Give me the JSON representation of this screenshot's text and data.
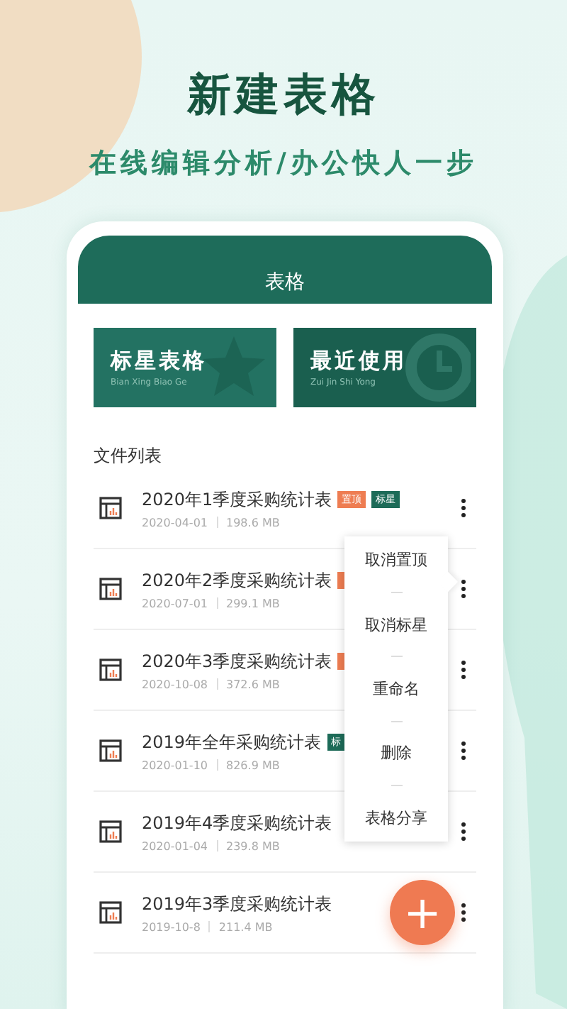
{
  "headline": "新建表格",
  "tagline": "在线编辑分析/办公快人一步",
  "app": {
    "title": "表格",
    "cards": [
      {
        "kind": "star",
        "title": "标星表格",
        "subtitle": "Bian Xing Biao Ge"
      },
      {
        "kind": "clock",
        "title": "最近使用",
        "subtitle": "Zui Jin Shi Yong"
      }
    ],
    "section_title": "文件列表",
    "files": [
      {
        "name": "2020年1季度采购统计表",
        "date": "2020-04-01",
        "size": "198.6 MB",
        "tags": [
          {
            "kind": "top",
            "label": "置顶"
          },
          {
            "kind": "star",
            "label": "标星"
          }
        ]
      },
      {
        "name": "2020年2季度采购统计表",
        "date": "2020-07-01",
        "size": "299.1 MB",
        "tags": [
          {
            "kind": "top"
          }
        ]
      },
      {
        "name": "2020年3季度采购统计表",
        "date": "2020-10-08",
        "size": "372.6 MB",
        "tags": [
          {
            "kind": "top"
          }
        ]
      },
      {
        "name": "2019年全年采购统计表",
        "date": "2020-01-10",
        "size": "826.9 MB",
        "tags": [
          {
            "kind": "star",
            "label": "标"
          }
        ]
      },
      {
        "name": "2019年4季度采购统计表",
        "date": "2020-01-04",
        "size": "239.8 MB"
      },
      {
        "name": "2019年3季度采购统计表",
        "date": "2019-10-8",
        "size": "211.4 MB"
      }
    ],
    "context_menu": {
      "items": [
        "取消置顶",
        "取消标星",
        "重命名",
        "删除",
        "表格分享"
      ]
    },
    "fab": {
      "label": "+"
    }
  }
}
